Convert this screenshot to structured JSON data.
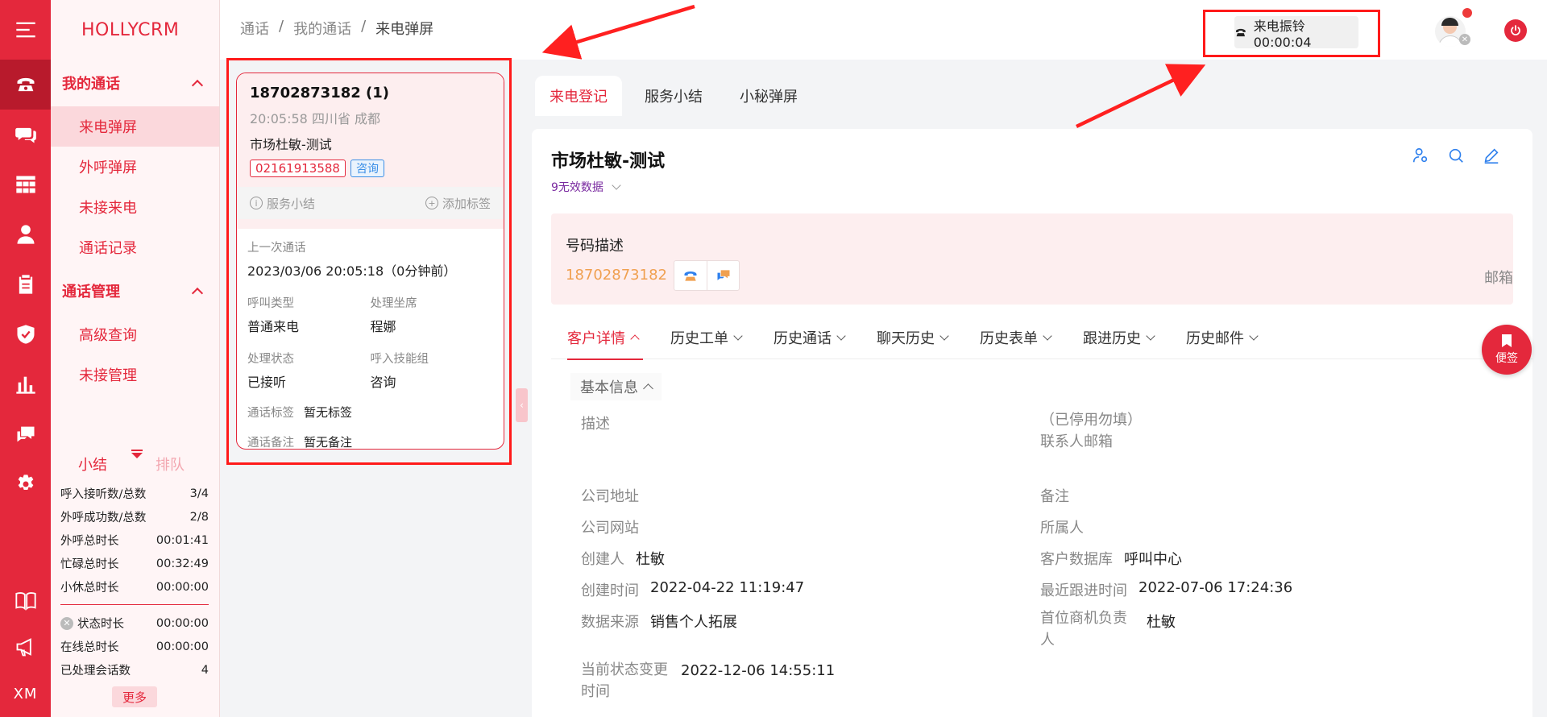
{
  "brand": "HOLLYCRM",
  "rail": {
    "icons": [
      "menu-icon",
      "phone-icon",
      "chat-icon",
      "grid-icon",
      "user-icon",
      "clipboard-icon",
      "shield-icon",
      "bar-chart-icon",
      "message-icon",
      "gear-icon",
      "book-icon",
      "megaphone-icon"
    ],
    "bottom_text": "XM"
  },
  "sidebar": {
    "groups": [
      {
        "title": "我的通话",
        "items": [
          "来电弹屏",
          "外呼弹屏",
          "未接来电",
          "通话记录"
        ]
      },
      {
        "title": "通话管理",
        "items": [
          "高级查询",
          "未接管理"
        ]
      }
    ],
    "stats_tabs": [
      "小结",
      "排队"
    ],
    "stats": [
      {
        "label": "呼入接听数/总数",
        "value": "3/4"
      },
      {
        "label": "外呼成功数/总数",
        "value": "2/8"
      },
      {
        "label": "外呼总时长",
        "value": "00:01:41"
      },
      {
        "label": "忙碌总时长",
        "value": "00:32:49"
      },
      {
        "label": "小休总时长",
        "value": "00:00:00"
      }
    ],
    "stats2": [
      {
        "label": "状态时长",
        "value": "00:00:00"
      },
      {
        "label": "在线总时长",
        "value": "00:00:00"
      },
      {
        "label": "已处理会话数",
        "value": "4"
      }
    ],
    "more": "更多"
  },
  "breadcrumb": [
    "通话",
    "我的通话",
    "来电弹屏"
  ],
  "ringing": {
    "label": "来电振铃 00:00:04"
  },
  "card": {
    "title": "18702873182 (1)",
    "sub": "20:05:58 四川省 成都",
    "name": "市场杜敏-测试",
    "tag_phone": "02161913588",
    "tag_type": "咨询",
    "action_summary": "服务小结",
    "action_tag": "添加标签",
    "last_call_label": "上一次通话",
    "last_call_value": "2023/03/06 20:05:18（0分钟前）",
    "call_type_label": "呼叫类型",
    "call_type_value": "普通来电",
    "agent_label": "处理坐席",
    "agent_value": "程娜",
    "status_label": "处理状态",
    "status_value": "已接听",
    "skill_label": "呼入技能组",
    "skill_value": "咨询",
    "tags_label": "通话标签",
    "tags_value": "暂无标签",
    "notes_label": "通话备注",
    "notes_value": "暂无备注"
  },
  "main_tabs": [
    "来电登记",
    "服务小结",
    "小秘弹屏"
  ],
  "panel": {
    "title": "市场杜敏-测试",
    "invalid": "9无效数据",
    "num_label": "号码描述",
    "num_value": "18702873182",
    "mail_label": "邮箱",
    "sub_tabs": [
      "客户详情",
      "历史工单",
      "历史通话",
      "聊天历史",
      "历史表单",
      "跟进历史",
      "历史邮件"
    ],
    "basic_info": "基本信息",
    "fields_left": [
      {
        "k": "描述",
        "v": ""
      },
      {
        "k": "公司地址",
        "v": ""
      },
      {
        "k": "公司网站",
        "v": ""
      },
      {
        "k": "创建人",
        "v": "杜敏"
      },
      {
        "k": "创建时间",
        "v": "2022-04-22 11:19:47"
      },
      {
        "k": "数据来源",
        "v": "销售个人拓展"
      },
      {
        "k": "当前状态变更时间",
        "v": "2022-12-06 14:55:11"
      }
    ],
    "fields_right": [
      {
        "k": "（已停用勿填）联系人邮箱",
        "v": ""
      },
      {
        "k": "备注",
        "v": ""
      },
      {
        "k": "所属人",
        "v": ""
      },
      {
        "k": "客户数据库",
        "v": "呼叫中心"
      },
      {
        "k": "最近跟进时间",
        "v": "2022-07-06 17:24:36"
      },
      {
        "k": "首位商机负责人",
        "v": "杜敏"
      }
    ]
  },
  "sticky": "便签",
  "colors": {
    "brand_red": "#e4283c",
    "annotation_red": "#ff1a1a",
    "link_blue": "#2f80ed",
    "phone_orange": "#f0a050"
  }
}
